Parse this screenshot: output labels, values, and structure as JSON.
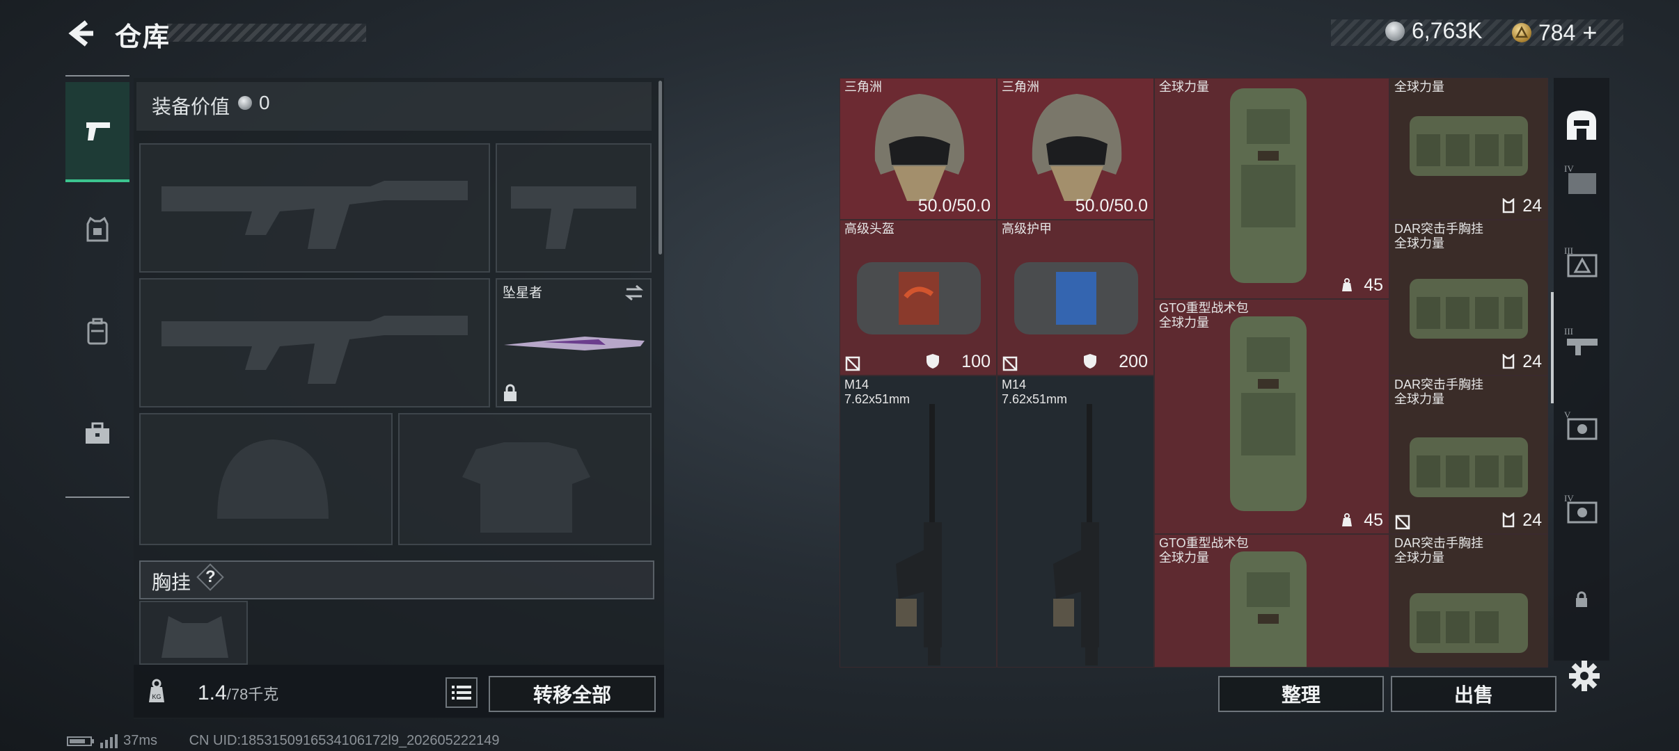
{
  "header": {
    "title": "仓库",
    "back_icon": "back-arrow-icon",
    "currencies": [
      {
        "icon": "silver-coin-icon",
        "value": "6,763K",
        "color": "#c8ccd0"
      },
      {
        "icon": "gold-triangle-coin-icon",
        "value": "784",
        "suffix": "+",
        "color": "#d6b25e"
      }
    ]
  },
  "left_nav": {
    "items": [
      {
        "name": "weapons",
        "icon": "pistol-icon",
        "active": true
      },
      {
        "name": "armor",
        "icon": "vest-icon",
        "active": false
      },
      {
        "name": "backpack",
        "icon": "backpack-icon",
        "active": false
      },
      {
        "name": "toolbox",
        "icon": "toolbox-icon",
        "active": false
      }
    ]
  },
  "equipment": {
    "value_label": "装备价值",
    "value": "0",
    "melee_name": "坠星者",
    "chest_rig_label": "胸挂",
    "help": "?",
    "weight_current": "1.4",
    "weight_max": "/78千克",
    "transfer_all": "转移全部"
  },
  "grid": {
    "cells": [
      {
        "id": "helmet-1",
        "label": "三角洲",
        "value": "50.0/50.0"
      },
      {
        "id": "helmet-2",
        "label": "三角洲",
        "value": "50.0/50.0"
      },
      {
        "id": "backpack-top",
        "label": "全球力量",
        "value": "45"
      },
      {
        "id": "rig-top",
        "label": "全球力量",
        "value": "24"
      },
      {
        "id": "bag-helmet",
        "label": "高级头盔",
        "value": "100"
      },
      {
        "id": "bag-armor",
        "label": "高级护甲",
        "value": "200"
      },
      {
        "id": "rig-2",
        "label": "DAR突击手胸挂",
        "sublabel": "全球力量",
        "value": "24"
      },
      {
        "id": "backpack-2",
        "label": "GTO重型战术包",
        "sublabel": "全球力量",
        "value": "45"
      },
      {
        "id": "m14-1",
        "label": "M14",
        "sublabel": "7.62x51mm"
      },
      {
        "id": "m14-2",
        "label": "M14",
        "sublabel": "7.62x51mm"
      },
      {
        "id": "rig-3",
        "label": "DAR突击手胸挂",
        "sublabel": "全球力量",
        "value": "24"
      },
      {
        "id": "backpack-3",
        "label": "GTO重型战术包",
        "sublabel": "全球力量"
      },
      {
        "id": "rig-4",
        "label": "DAR突击手胸挂",
        "sublabel": "全球力量"
      }
    ]
  },
  "actions": {
    "sort": "整理",
    "sell": "出售"
  },
  "right_nav": {
    "items": [
      {
        "icon": "stash-icon"
      },
      {
        "icon": "tier-4-helmet-icon",
        "tier": "IV"
      },
      {
        "icon": "tier-3-armor-icon",
        "tier": "III"
      },
      {
        "icon": "tier-3-weapon-icon",
        "tier": "III"
      },
      {
        "icon": "tier-5-item-icon",
        "tier": "V"
      },
      {
        "icon": "tier-4-item-icon",
        "tier": "IV"
      },
      {
        "icon": "lock-icon"
      }
    ]
  },
  "status": {
    "ping": "37ms",
    "uid": "CN UID:1853150916534106172l9_202605222149"
  }
}
